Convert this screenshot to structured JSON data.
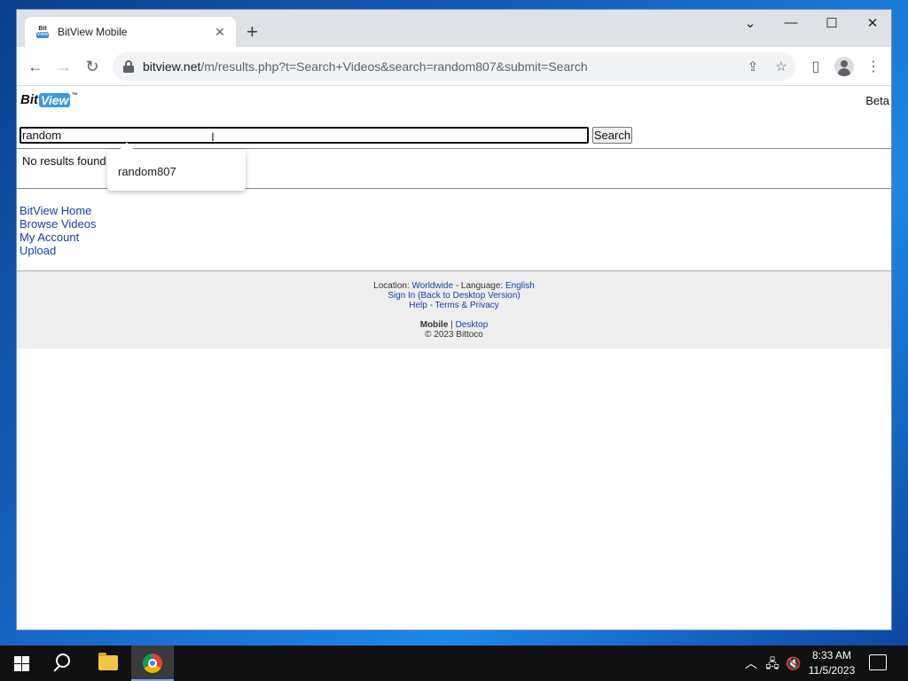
{
  "browser": {
    "tab_title": "BitView Mobile",
    "tab_close": "✕",
    "new_tab": "+",
    "window_controls": {
      "dropdown": "⌄",
      "minimize": "—",
      "maximize": "☐",
      "close": "✕"
    },
    "nav": {
      "back": "←",
      "forward": "→",
      "reload": "↻"
    },
    "url_domain": "bitview.net",
    "url_rest": "/m/results.php?t=Search+Videos&search=random807&submit=Search",
    "toolbar_icons": {
      "share": "⇪",
      "bookmark": "☆",
      "side_panel": "▯",
      "menu": "⋮"
    }
  },
  "site": {
    "logo_bit": "Bit",
    "logo_view": "View",
    "logo_tm": "™",
    "beta": "Beta",
    "search_value": "random",
    "search_button": "Search",
    "no_results": "No results found",
    "suggestion": "random807",
    "nav_links": [
      "BitView Home",
      "Browse Videos",
      "My Account",
      "Upload"
    ],
    "footer": {
      "location_label": "Location:",
      "location_value": "Worldwide",
      "language_label": "- Language:",
      "language_value": "English",
      "sign_in": "Sign In",
      "desktop_version": "(Back to Desktop Version)",
      "help": "Help",
      "terms": "Terms & Privacy",
      "mobile": "Mobile",
      "separator": "|",
      "desktop": "Desktop",
      "copyright": "© 2023 Bittoco"
    }
  },
  "taskbar": {
    "tray_up": "︿",
    "network": "🖧",
    "volume": "🔇",
    "time": "8:33 AM",
    "date": "11/5/2023"
  },
  "colors": {
    "link": "#1a3ea8",
    "logo_view_bg": "#3a9ae0",
    "footer_bg": "#eeeeee",
    "taskbar": "#101010"
  }
}
